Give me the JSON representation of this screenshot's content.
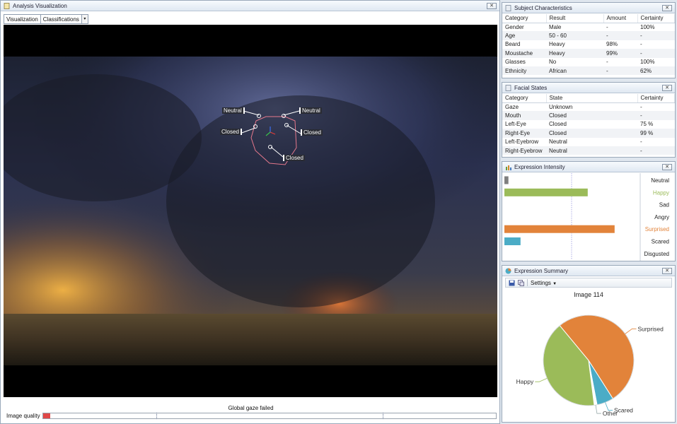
{
  "main": {
    "title": "Analysis Visualization",
    "tabs": [
      {
        "label": "Visualization"
      },
      {
        "label": "Classifications"
      }
    ],
    "gaze_status": "Global gaze failed",
    "image_quality_label": "Image quality",
    "image_quality_value": 0.015,
    "face_labels": {
      "left_brow": "Neutral",
      "right_brow": "Neutral",
      "left_eye": "Closed",
      "right_eye": "Closed",
      "mouth": "Closed"
    }
  },
  "subject": {
    "title": "Subject Characteristics",
    "headers": [
      "Category",
      "Result",
      "Amount",
      "Certainty"
    ],
    "rows": [
      [
        "Gender",
        "Male",
        "-",
        "100%"
      ],
      [
        "Age",
        "50 - 60",
        "-",
        "-"
      ],
      [
        "Beard",
        "Heavy",
        "98%",
        "-"
      ],
      [
        "Moustache",
        "Heavy",
        "99%",
        "-"
      ],
      [
        "Glasses",
        "No",
        "-",
        "100%"
      ],
      [
        "Ethnicity",
        "African",
        "-",
        "62%"
      ]
    ]
  },
  "facial": {
    "title": "Facial States",
    "headers": [
      "Category",
      "State",
      "Certainty"
    ],
    "rows": [
      [
        "Gaze",
        "Unknown",
        "-"
      ],
      [
        "Mouth",
        "Closed",
        "-"
      ],
      [
        "Left-Eye",
        "Closed",
        "75 %"
      ],
      [
        "Right-Eye",
        "Closed",
        "99 %"
      ],
      [
        "Left-Eyebrow",
        "Neutral",
        "-"
      ],
      [
        "Right-Eyebrow",
        "Neutral",
        "-"
      ]
    ]
  },
  "intensity": {
    "title": "Expression Intensity",
    "items": [
      {
        "label": "Neutral",
        "value": 0.03,
        "color": "#7f7f7f",
        "label_color": "#222222"
      },
      {
        "label": "Happy",
        "value": 0.62,
        "color": "#9bbb59",
        "label_color": "#9bbb59"
      },
      {
        "label": "Sad",
        "value": 0.0,
        "color": "#4f81bd",
        "label_color": "#222222"
      },
      {
        "label": "Angry",
        "value": 0.0,
        "color": "#c0504d",
        "label_color": "#222222"
      },
      {
        "label": "Surprised",
        "value": 0.82,
        "color": "#e2833a",
        "label_color": "#e2833a"
      },
      {
        "label": "Scared",
        "value": 0.12,
        "color": "#4bacc6",
        "label_color": "#222222"
      },
      {
        "label": "Disgusted",
        "value": 0.0,
        "color": "#8064a2",
        "label_color": "#222222"
      }
    ]
  },
  "summary": {
    "title": "Expression Summary",
    "settings_label": "Settings",
    "chart_data": {
      "type": "pie",
      "title": "Image 114",
      "slices": [
        {
          "label": "Surprised",
          "value": 52,
          "color": "#e2833a"
        },
        {
          "label": "Scared",
          "value": 6,
          "color": "#4bacc6"
        },
        {
          "label": "Other",
          "value": 1,
          "color": "#ffffff"
        },
        {
          "label": "Happy",
          "value": 41,
          "color": "#9bbb59"
        }
      ]
    }
  }
}
